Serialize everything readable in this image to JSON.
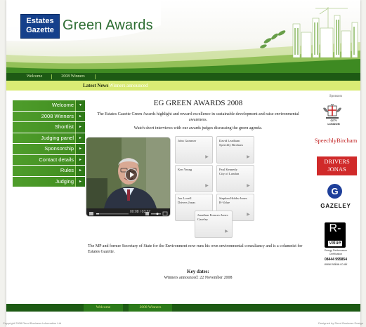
{
  "header": {
    "logo_line1": "Estates",
    "logo_line2": "Gazette",
    "title": "Green Awards"
  },
  "top_nav": {
    "items": [
      {
        "label": "Welcome"
      },
      {
        "label": "2008 Winners"
      }
    ]
  },
  "news": {
    "label": "Latest News",
    "value": "Winners announced"
  },
  "sidebar": {
    "items": [
      {
        "label": "Welcome",
        "arrow": "▾"
      },
      {
        "label": "2008 Winners",
        "arrow": "▸"
      },
      {
        "label": "Shortlist",
        "arrow": "▸"
      },
      {
        "label": "Judging panel",
        "arrow": "▸"
      },
      {
        "label": "Sponsorship",
        "arrow": "▸"
      },
      {
        "label": "Contact details",
        "arrow": "▸"
      },
      {
        "label": "Rules",
        "arrow": "▸"
      },
      {
        "label": "Judging",
        "arrow": "▸"
      }
    ]
  },
  "main": {
    "title": "EG GREEN AWARDS 2008",
    "intro": "The Estates Gazette Green Awards highlight and reward excellence in sustainable development and raise environmental awareness.",
    "watch": "Watch short interviews with our awards judges discussing the green agenda.",
    "video": {
      "time": "00:08 / 03:37"
    },
    "judges": [
      {
        "name": "John Gummer"
      },
      {
        "name": "David Leadham\nSpeechly Bircham"
      },
      {
        "name": "Ken Yeang"
      },
      {
        "name": "Paul Kennedy\nCity of London"
      },
      {
        "name": "Jon Lovell\nDrivers Jonas"
      },
      {
        "name": "Stephen Hobbs-Jones\nR-Value"
      },
      {
        "name": "Jonathan Frances-Jones\nGazeley"
      }
    ],
    "description": "The MP and former Secretary of State for the Environment now runs his own environmental consultancy and is a columnist for Estates Gazette.",
    "key_dates_title": "Key dates:",
    "key_dates_text": "Winners announced: 22 November 2008"
  },
  "sponsors": {
    "title": "Sponsors",
    "city_label": "CITY\nLONDON",
    "speechly": "SpeechlyBircham",
    "drivers": "DRIVERS\nJONAS",
    "gazeley_icon": "G",
    "gazeley": "GAZELEY",
    "rvalue_letter": "R-",
    "rvalue_word": "value",
    "rvalue_sub": "Energy Performance\nCertification",
    "rvalue_phone": "08444 995854",
    "rvalue_url": "www.rvalue.co.uk"
  },
  "footer": {
    "nav": [
      {
        "label": "Welcome"
      },
      {
        "label": "2008 Winners"
      }
    ],
    "copyright": "Copyright 2008 Reed Business Information Ltd",
    "credit": "Designed by Reed Business Design"
  },
  "colors": {
    "nav_green": "#1d5a14",
    "side_green": "#4f9d2b",
    "news_yellow": "#d9eb74",
    "brand_blue": "#15408b",
    "sponsor_red": "#d02a2a"
  }
}
